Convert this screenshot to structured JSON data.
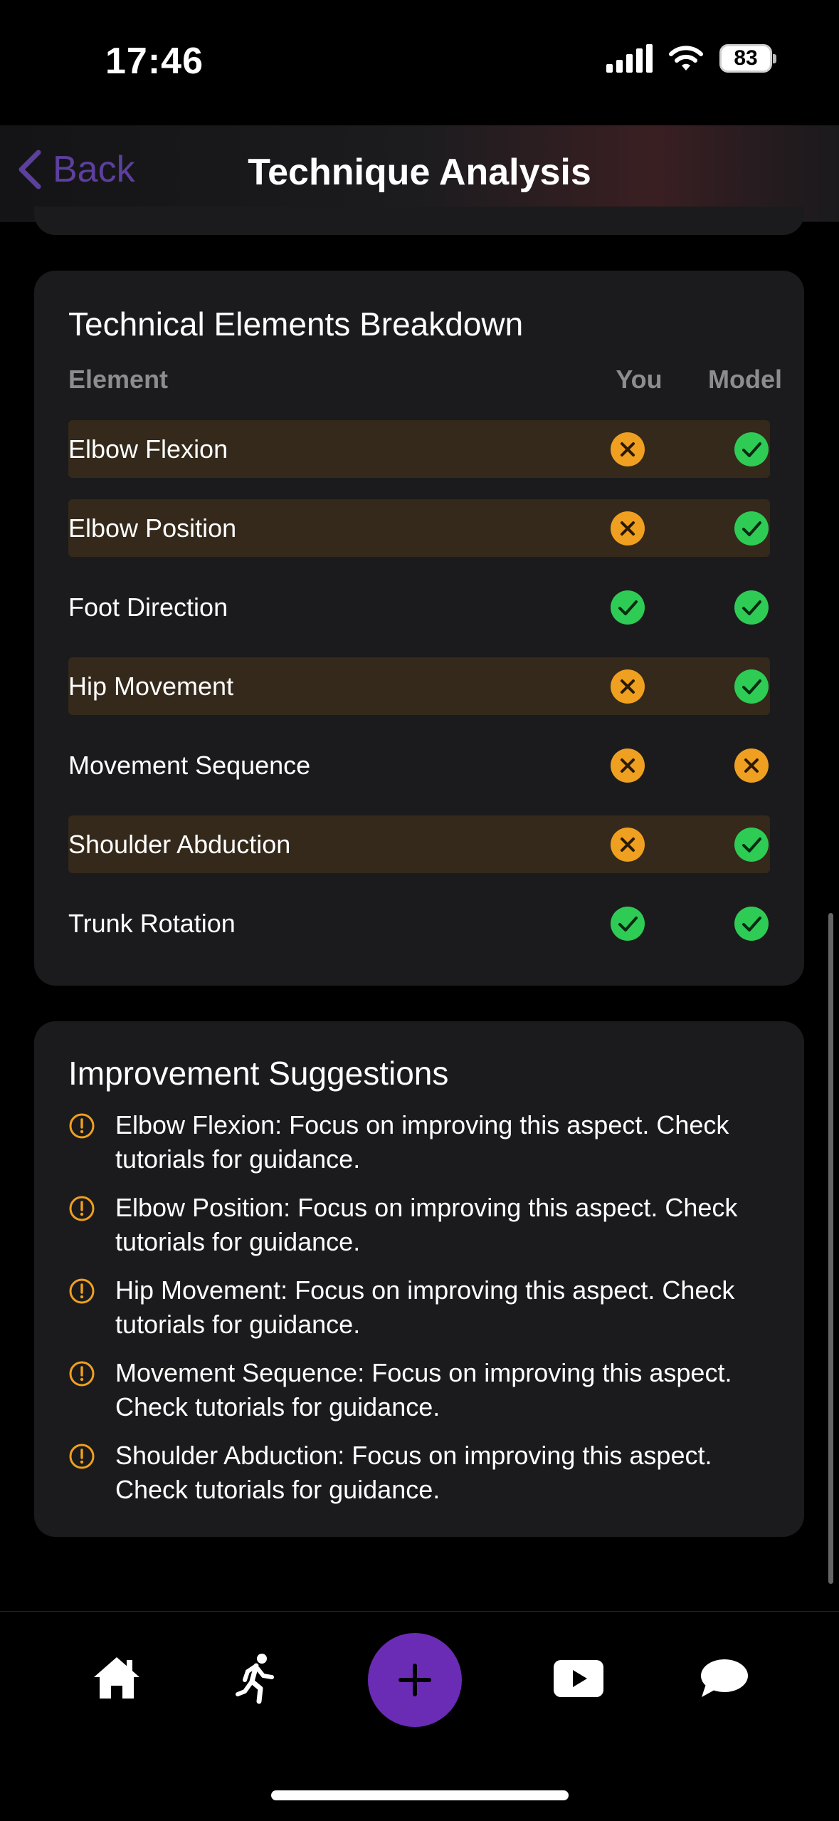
{
  "status_bar": {
    "time": "17:46",
    "battery": "83"
  },
  "nav": {
    "back_label": "Back",
    "title": "Technique Analysis"
  },
  "breakdown": {
    "title": "Technical Elements Breakdown",
    "columns": {
      "element": "Element",
      "you": "You",
      "model": "Model"
    },
    "rows": [
      {
        "label": "Elbow Flexion",
        "you": "cross",
        "model": "check",
        "highlight": true
      },
      {
        "label": "Elbow Position",
        "you": "cross",
        "model": "check",
        "highlight": true
      },
      {
        "label": "Foot Direction",
        "you": "check",
        "model": "check",
        "highlight": false
      },
      {
        "label": "Hip Movement",
        "you": "cross",
        "model": "check",
        "highlight": true
      },
      {
        "label": "Movement Sequence",
        "you": "cross",
        "model": "cross",
        "highlight": false
      },
      {
        "label": "Shoulder Abduction",
        "you": "cross",
        "model": "check",
        "highlight": true
      },
      {
        "label": "Trunk Rotation",
        "you": "check",
        "model": "check",
        "highlight": false
      }
    ]
  },
  "suggestions": {
    "title": "Improvement Suggestions",
    "items": [
      "Elbow Flexion: Focus on improving this aspect. Check tutorials for guidance.",
      "Elbow Position: Focus on improving this aspect. Check tutorials for guidance.",
      "Hip Movement: Focus on improving this aspect. Check tutorials for guidance.",
      "Movement Sequence: Focus on improving this aspect. Check tutorials for guidance.",
      "Shoulder Abduction: Focus on improving this aspect. Check tutorials for guidance."
    ]
  },
  "tab_bar": {
    "items": [
      {
        "name": "home-icon"
      },
      {
        "name": "running-figure-icon"
      },
      {
        "name": "plus-icon"
      },
      {
        "name": "play-video-icon"
      },
      {
        "name": "chat-bubble-icon"
      }
    ]
  },
  "colors": {
    "accent": "#6a2bb5",
    "check": "#2ecc55",
    "cross": "#f0a020",
    "highlight_row": "#34291a"
  }
}
